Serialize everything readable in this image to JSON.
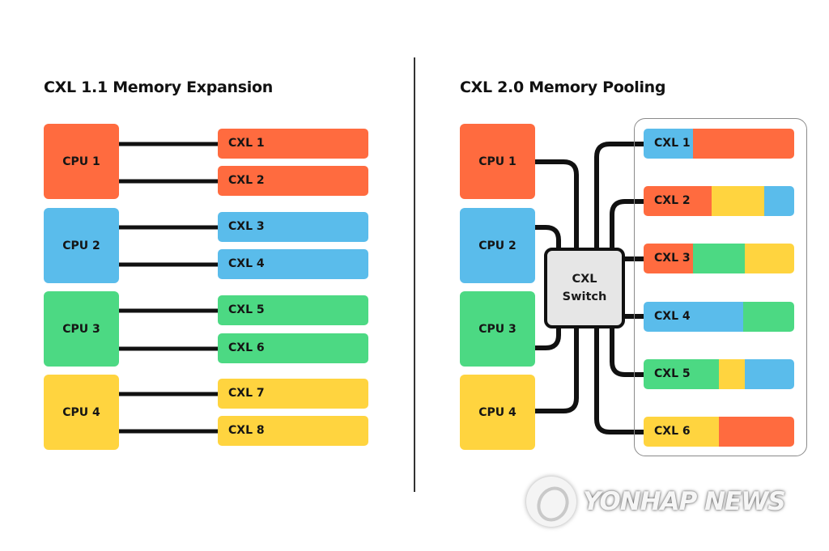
{
  "colors": {
    "orange": "#FF6B3F",
    "blue": "#5ABCEB",
    "green": "#4CD983",
    "yellow": "#FFD43F",
    "wire": "#111111",
    "switch_fill": "#E6E6E6"
  },
  "left": {
    "title": "CXL 1.1 Memory Expansion",
    "cpus": [
      {
        "label": "CPU 1",
        "color": "orange"
      },
      {
        "label": "CPU 2",
        "color": "blue"
      },
      {
        "label": "CPU 3",
        "color": "green"
      },
      {
        "label": "CPU 4",
        "color": "yellow"
      }
    ],
    "devices": [
      {
        "label": "CXL 1",
        "color": "orange",
        "cpu": 0
      },
      {
        "label": "CXL 2",
        "color": "orange",
        "cpu": 0
      },
      {
        "label": "CXL 3",
        "color": "blue",
        "cpu": 1
      },
      {
        "label": "CXL 4",
        "color": "blue",
        "cpu": 1
      },
      {
        "label": "CXL 5",
        "color": "green",
        "cpu": 2
      },
      {
        "label": "CXL 6",
        "color": "green",
        "cpu": 2
      },
      {
        "label": "CXL 7",
        "color": "yellow",
        "cpu": 3
      },
      {
        "label": "CXL 8",
        "color": "yellow",
        "cpu": 3
      }
    ]
  },
  "right": {
    "title": "CXL 2.0 Memory Pooling",
    "cpus": [
      {
        "label": "CPU 1",
        "color": "orange"
      },
      {
        "label": "CPU 2",
        "color": "blue"
      },
      {
        "label": "CPU 3",
        "color": "green"
      },
      {
        "label": "CPU 4",
        "color": "yellow"
      }
    ],
    "switch": {
      "line1": "CXL",
      "line2": "Switch"
    },
    "pooled_devices": [
      {
        "label": "CXL 1",
        "segments": [
          {
            "color": "blue",
            "share": 0.33
          },
          {
            "color": "orange",
            "share": 0.67
          }
        ]
      },
      {
        "label": "CXL 2",
        "segments": [
          {
            "color": "orange",
            "share": 0.45
          },
          {
            "color": "yellow",
            "share": 0.35
          },
          {
            "color": "blue",
            "share": 0.2
          }
        ]
      },
      {
        "label": "CXL 3",
        "segments": [
          {
            "color": "orange",
            "share": 0.33
          },
          {
            "color": "green",
            "share": 0.34
          },
          {
            "color": "yellow",
            "share": 0.33
          }
        ]
      },
      {
        "label": "CXL 4",
        "segments": [
          {
            "color": "blue",
            "share": 0.66
          },
          {
            "color": "green",
            "share": 0.34
          }
        ]
      },
      {
        "label": "CXL 5",
        "segments": [
          {
            "color": "green",
            "share": 0.5
          },
          {
            "color": "yellow",
            "share": 0.17
          },
          {
            "color": "blue",
            "share": 0.33
          }
        ]
      },
      {
        "label": "CXL 6",
        "segments": [
          {
            "color": "yellow",
            "share": 0.5
          },
          {
            "color": "orange",
            "share": 0.5
          }
        ]
      }
    ]
  },
  "watermark": {
    "text": "YONHAP NEWS",
    "icon": "yonhap-logo-icon"
  }
}
